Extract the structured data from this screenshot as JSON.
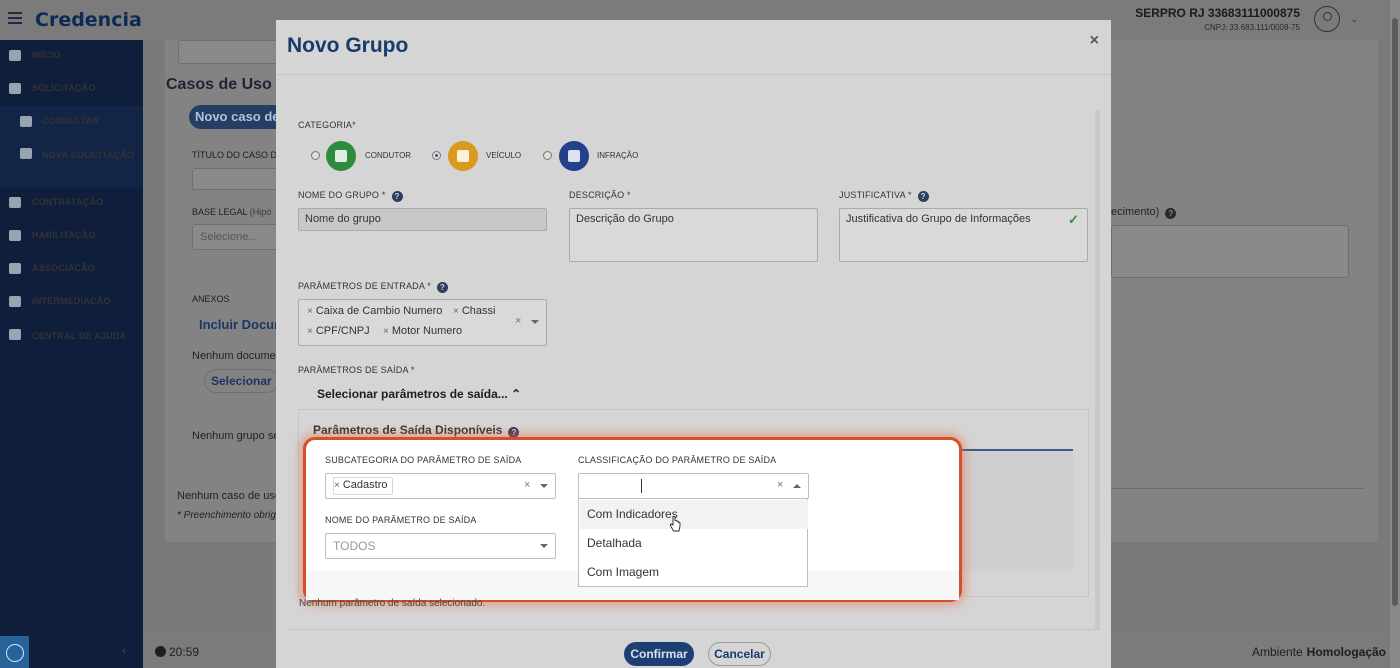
{
  "topbar": {
    "brand": "Credencia",
    "org_name": "SERPRO RJ 33683111000875",
    "org_cnpj": "CNPJ: 33.683.111/0008-75"
  },
  "sidebar": {
    "items": [
      {
        "label": "INÍCIO",
        "icon": "home-icon"
      },
      {
        "label": "SOLICITAÇÃO",
        "icon": "edit-icon"
      },
      {
        "label": "CONSULTAR",
        "icon": "search-icon"
      },
      {
        "label": "NOVA SOLICITAÇÃO",
        "icon": "file-icon"
      },
      {
        "label": "CONTRATAÇÃO",
        "icon": "handshake-icon"
      },
      {
        "label": "HABILITAÇÃO",
        "icon": "id-card-icon"
      },
      {
        "label": "ASSOCIAÇÃO",
        "icon": "users-icon"
      },
      {
        "label": "INTERMEDIAÇÃO",
        "icon": "user-tie-icon"
      },
      {
        "label": "CENTRAL DE AJUDA",
        "icon": "question-icon"
      }
    ]
  },
  "background": {
    "section_title": "Casos de Uso",
    "new_case_button": "Novo caso de",
    "title_label": "TÍTULO DO CASO D",
    "legal_base_label": "BASE LEGAL",
    "legal_base_hint": "(Hipó",
    "legal_base_placeholder": "Selecione...",
    "attachments_label": "ANEXOS",
    "include_docs": "Incluir Docum",
    "no_docs": "Nenhum documen",
    "select_button": "Selecionar",
    "no_group": "Nenhum grupo sel",
    "no_use_case": "Nenhum caso de uso",
    "required_note": "* Preenchimento obrig",
    "right_label_fragment": "ecimento)"
  },
  "footer": {
    "time": "20:59",
    "env_label": "Ambiente",
    "env_value": "Homologação"
  },
  "modal": {
    "title": "Novo Grupo",
    "close": "×",
    "category_label": "CATEGORIA",
    "categories": [
      {
        "label": "CONDUTOR",
        "checked": false,
        "color": "#2e8b3e"
      },
      {
        "label": "VEÍCULO",
        "checked": true,
        "color": "#d99a1f"
      },
      {
        "label": "INFRAÇÃO",
        "checked": false,
        "color": "#23418a"
      }
    ],
    "group_name_label": "NOME DO GRUPO",
    "group_name_value": "Nome do grupo",
    "description_label": "DESCRIÇÃO",
    "description_value": "Descrição do Grupo",
    "justification_label": "JUSTIFICATIVA",
    "justification_value": "Justificativa do Grupo de Informações",
    "input_params_label": "PARÂMETROS DE ENTRADA",
    "input_params": [
      "Caixa de Cambio Numero",
      "Chassi",
      "CPF/CNPJ",
      "Motor Numero"
    ],
    "output_params_label": "PARÂMETROS DE SAÍDA",
    "output_toggle": "Selecionar parâmetros de saída...",
    "available_title": "Parâmetros de Saída Disponíveis",
    "subcategory_label": "SUBCATEGORIA DO PARÂMETRO DE SAÍDA",
    "subcategory_chip": "Cadastro",
    "classification_label": "CLASSIFICAÇÃO DO PARÂMETRO DE SAÍDA",
    "classification_options": [
      "Com Indicadores",
      "Detalhada",
      "Com Imagem"
    ],
    "param_name_label": "NOME DO PARÂMETRO DE SAÍDA",
    "param_name_placeholder": "TODOS",
    "empty_note": "Nenhum parâmetro de saída selecionado.",
    "confirm": "Confirmar",
    "cancel": "Cancelar",
    "required_mark": "*"
  },
  "colors": {
    "sidebar": "#0f1e3a",
    "primary": "#1d3f73",
    "highlight": "#d2502a"
  }
}
